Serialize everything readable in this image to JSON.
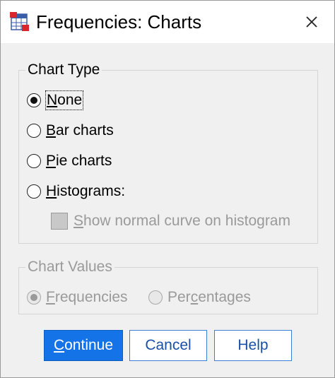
{
  "window": {
    "title": "Frequencies: Charts",
    "icons": {
      "app": "spss-table-icon",
      "close": "close-icon"
    }
  },
  "chart_type": {
    "legend": "Chart Type",
    "options": [
      {
        "label": "None",
        "selected": true
      },
      {
        "label": "Bar charts",
        "selected": false
      },
      {
        "label": "Pie charts",
        "selected": false
      },
      {
        "label": "Histograms:",
        "selected": false
      }
    ],
    "show_normal_curve": {
      "label": "Show normal curve on histogram",
      "checked": false,
      "enabled": false
    }
  },
  "chart_values": {
    "legend": "Chart Values",
    "enabled": false,
    "options": [
      {
        "label": "Frequencies",
        "selected": true
      },
      {
        "label": "Percentages",
        "selected": false
      }
    ]
  },
  "buttons": {
    "continue": "Continue",
    "cancel": "Cancel",
    "help": "Help"
  },
  "colors": {
    "primary_button": "#1473e6",
    "button_border": "#3c7fd6",
    "disabled_text": "#9a9a9a"
  }
}
